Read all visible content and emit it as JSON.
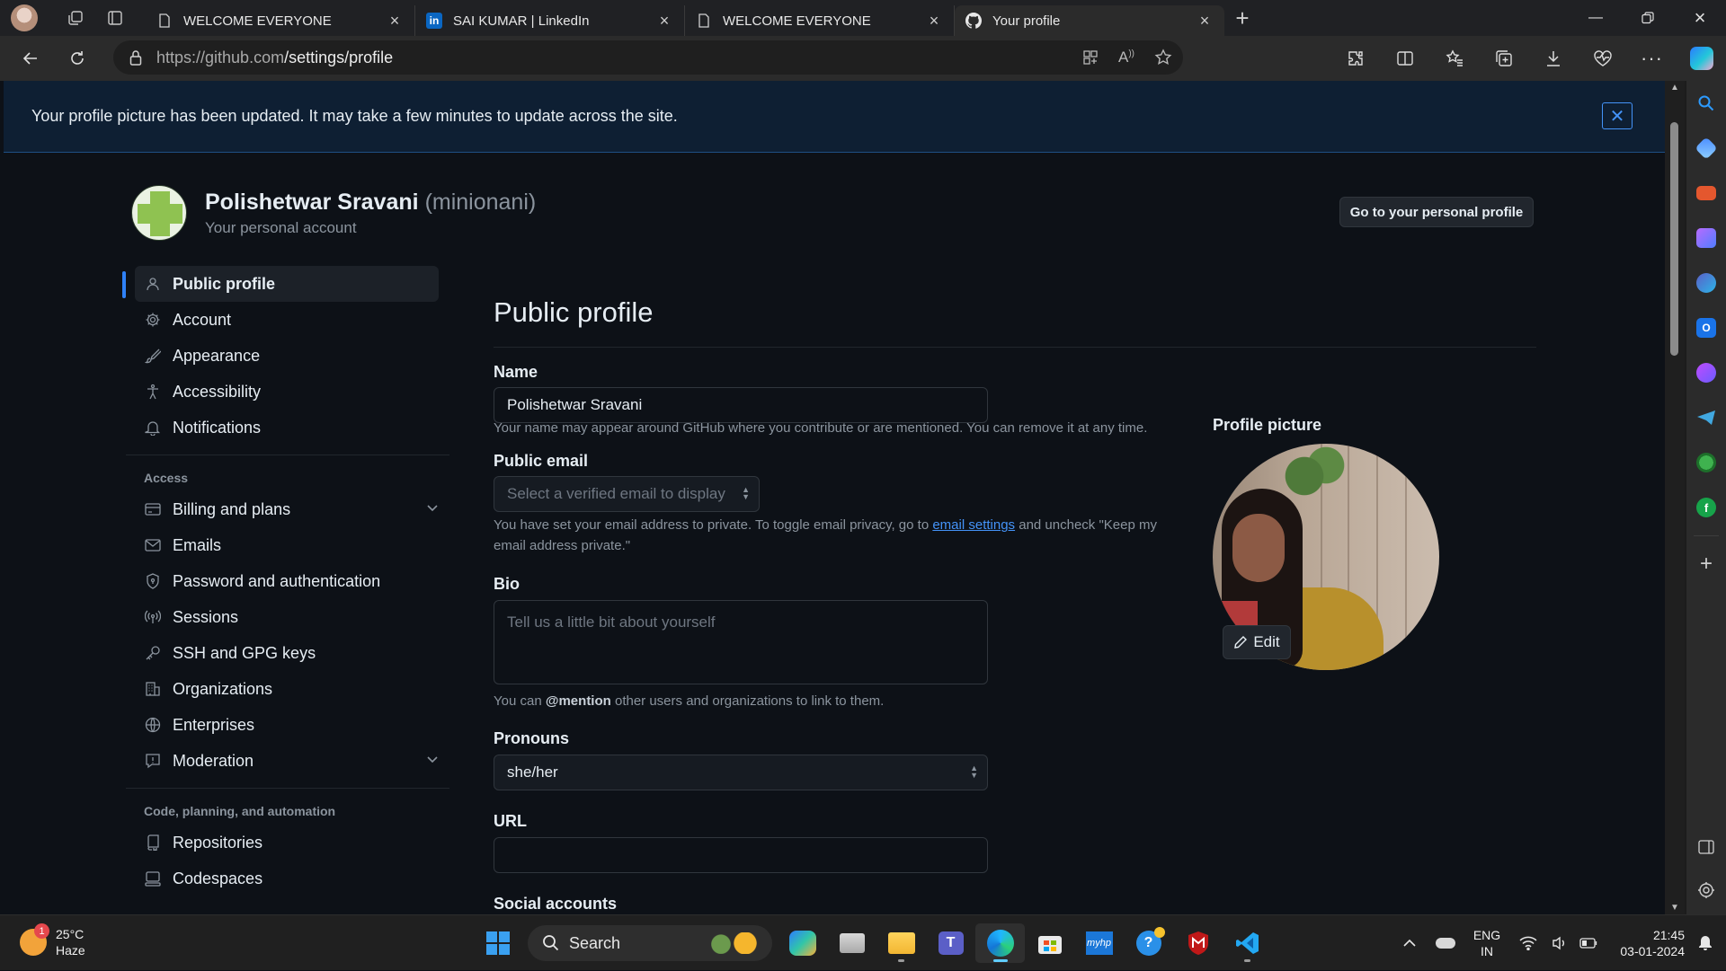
{
  "browser": {
    "tabs": [
      {
        "title": "WELCOME EVERYONE",
        "icon": "page-icon"
      },
      {
        "title": "SAI KUMAR | LinkedIn",
        "icon": "linkedin-icon"
      },
      {
        "title": "WELCOME EVERYONE",
        "icon": "page-icon"
      },
      {
        "title": "Your profile",
        "icon": "github-icon"
      }
    ],
    "url_host": "https://github.com",
    "url_path": "/settings/profile"
  },
  "flash": {
    "message": "Your profile picture has been updated. It may take a few minutes to update across the site."
  },
  "account": {
    "name": "Polishetwar Sravani",
    "username": "(minionani)",
    "subtitle": "Your personal account",
    "go_profile_label": "Go to your personal profile"
  },
  "nav": {
    "top": [
      {
        "label": "Public profile",
        "icon": "person-icon"
      },
      {
        "label": "Account",
        "icon": "gear-icon"
      },
      {
        "label": "Appearance",
        "icon": "paintbrush-icon"
      },
      {
        "label": "Accessibility",
        "icon": "accessibility-icon"
      },
      {
        "label": "Notifications",
        "icon": "bell-icon"
      }
    ],
    "access_heading": "Access",
    "access": [
      {
        "label": "Billing and plans",
        "icon": "credit-card-icon"
      },
      {
        "label": "Emails",
        "icon": "mail-icon"
      },
      {
        "label": "Password and authentication",
        "icon": "shield-lock-icon"
      },
      {
        "label": "Sessions",
        "icon": "broadcast-icon"
      },
      {
        "label": "SSH and GPG keys",
        "icon": "key-icon"
      },
      {
        "label": "Organizations",
        "icon": "organization-icon"
      },
      {
        "label": "Enterprises",
        "icon": "globe-icon"
      },
      {
        "label": "Moderation",
        "icon": "report-icon"
      }
    ],
    "code_heading": "Code, planning, and automation",
    "code": [
      {
        "label": "Repositories",
        "icon": "repo-icon"
      },
      {
        "label": "Codespaces",
        "icon": "codespaces-icon"
      }
    ]
  },
  "form": {
    "title": "Public profile",
    "name_label": "Name",
    "name_value": "Polishetwar Sravani",
    "name_note": "Your name may appear around GitHub where you contribute or are mentioned. You can remove it at any time.",
    "email_label": "Public email",
    "email_placeholder": "Select a verified email to display",
    "email_note_1": "You have set your email address to private. To toggle email privacy, go to",
    "email_note_link": "email settings",
    "email_note_2": "and uncheck \"Keep my email address private.\"",
    "bio_label": "Bio",
    "bio_placeholder": "Tell us a little bit about yourself",
    "bio_note_1": "You can",
    "bio_note_mention": "@mention",
    "bio_note_2": "other users and organizations to link to them.",
    "pronouns_label": "Pronouns",
    "pronouns_value": "she/her",
    "url_label": "URL",
    "url_value": "",
    "social_label": "Social accounts",
    "picture_label": "Profile picture",
    "edit_label": "Edit"
  },
  "taskbar": {
    "weather_temp": "25°C",
    "weather_desc": "Haze",
    "weather_badge": "1",
    "search_label": "Search",
    "lang_1": "ENG",
    "lang_2": "IN",
    "time": "21:45",
    "date": "03-01-2024"
  },
  "colors": {
    "accent": "#2f81f7",
    "link": "#4493f8",
    "bg": "#0d1117",
    "flash_bg": "#0e1f33"
  }
}
